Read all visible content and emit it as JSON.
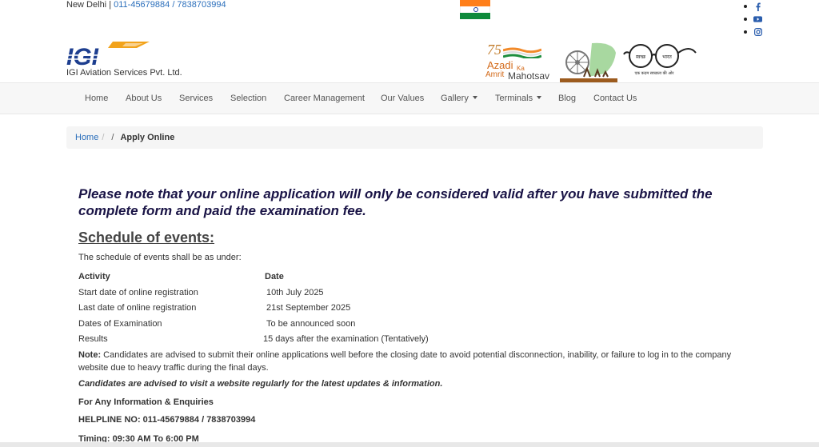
{
  "topbar": {
    "city": "New Delhi",
    "separator": "|",
    "phones": "011-45679884 / 7838703994"
  },
  "social": [
    "facebook-icon",
    "youtube-icon",
    "instagram-icon"
  ],
  "logo": {
    "mark_text": "IGI",
    "company": "IGI Aviation Services Pvt. Ltd."
  },
  "azadi": {
    "number": "75",
    "line1": "Azadi",
    "line2": "Ka",
    "line3": "Amrit",
    "line4": "Mahotsav"
  },
  "swachh": {
    "left_lens": "स्वच्छ",
    "right_lens": "भारत",
    "tagline": "एक कदम स्वच्छता की ओर"
  },
  "nav": {
    "items": [
      {
        "label": "Home"
      },
      {
        "label": "About Us"
      },
      {
        "label": "Services"
      },
      {
        "label": "Selection"
      },
      {
        "label": "Career Management"
      },
      {
        "label": "Our Values"
      },
      {
        "label": "Gallery"
      },
      {
        "label": "Terminals"
      },
      {
        "label": "Blog"
      },
      {
        "label": "Contact Us"
      }
    ]
  },
  "breadcrumb": {
    "home": "Home",
    "sep": "/",
    "sep2": "/",
    "current": "Apply Online"
  },
  "main": {
    "notice": "Please note that your online application will only be considered valid after you have submitted the complete form and paid the examination fee.",
    "schedule_title": "Schedule of events:",
    "schedule_intro": "The schedule of events shall be as under:",
    "table": {
      "head": [
        "Activity",
        "Date"
      ],
      "rows": [
        [
          "Start date of online registration",
          "10th July 2025"
        ],
        [
          "Last date of online registration",
          "21st September 2025"
        ],
        [
          "Dates of Examination",
          "To be announced soon"
        ],
        [
          "Results",
          "15 days after the examination (Tentatively)"
        ]
      ]
    },
    "note_label": "Note:",
    "note_text": "Candidates are advised to submit their online applications well before the closing date to avoid potential disconnection, inability, or failure to log in to the company website due to heavy traffic during the final days.",
    "advice": "Candidates are advised to visit a website regularly for the latest updates & information.",
    "enquiries": "For Any Information & Enquiries",
    "helpline": "HELPLINE NO: 011-45679884 / 7838703994",
    "timing": "Timing: 09:30 AM To 6:00 PM"
  }
}
